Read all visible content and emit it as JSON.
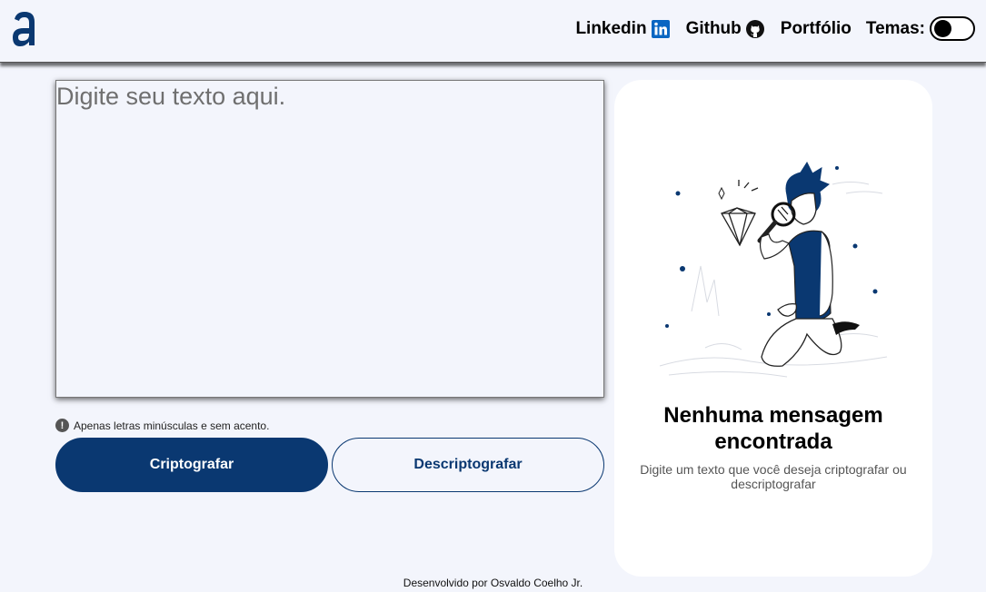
{
  "header": {
    "logo": "alura-logo",
    "links": [
      {
        "label": "Linkedin",
        "icon": "linkedin-icon"
      },
      {
        "label": "Github",
        "icon": "github-icon"
      },
      {
        "label": "Portfólio"
      }
    ],
    "theme_label": "Temas:",
    "theme_toggle_on": false
  },
  "editor": {
    "placeholder": "Digite seu texto aqui.",
    "value": ""
  },
  "hint": {
    "icon": "exclamation-icon",
    "text": "Apenas letras minúsculas e sem acento."
  },
  "buttons": {
    "encrypt": "Criptografar",
    "decrypt": "Descriptografar"
  },
  "result_panel": {
    "illustration": "person-with-magnifier-illustration",
    "title": "Nenhuma mensagem encontrada",
    "text": "Digite um texto que você deseja criptografar ou descriptografar"
  },
  "footer": {
    "text": "Desenvolvido por Osvaldo Coelho Jr."
  },
  "colors": {
    "primary": "#0a3871",
    "background": "#f3f5fc",
    "panel": "#ffffff"
  }
}
